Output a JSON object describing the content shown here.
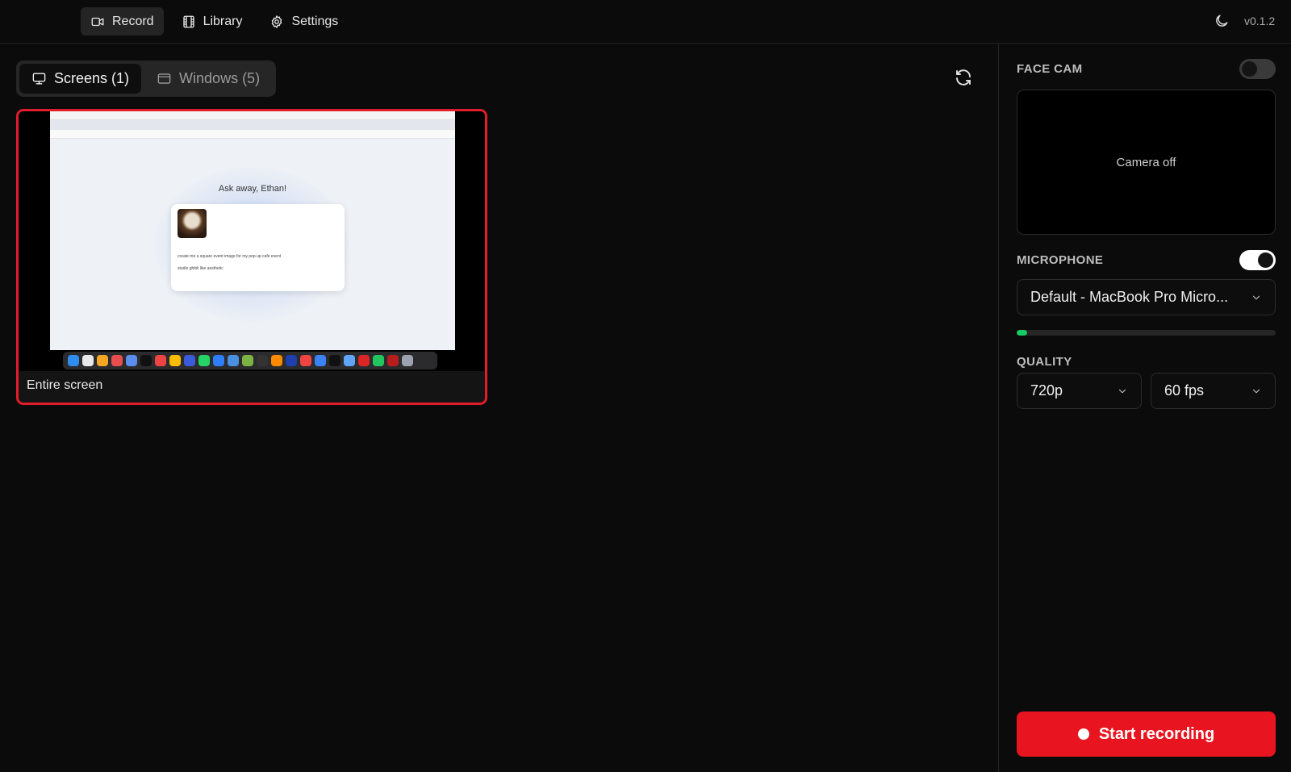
{
  "nav": {
    "items": [
      {
        "label": "Record",
        "icon": "video-camera-icon",
        "active": true
      },
      {
        "label": "Library",
        "icon": "film-icon",
        "active": false
      },
      {
        "label": "Settings",
        "icon": "gear-icon",
        "active": false
      }
    ]
  },
  "header": {
    "version": "v0.1.2",
    "theme_icon": "moon-icon"
  },
  "sources": {
    "tabs": [
      {
        "label": "Screens (1)",
        "icon": "monitor-icon",
        "active": true
      },
      {
        "label": "Windows (5)",
        "icon": "window-icon",
        "active": false
      }
    ],
    "refresh_icon": "refresh-icon",
    "cards": [
      {
        "label": "Entire screen",
        "selected": true,
        "preview": {
          "greeting": "Ask away, Ethan!",
          "prompt_line_1": "create me a square event image for my pop up cafe event",
          "prompt_line_2": "studio ghibli like aesthetic"
        }
      }
    ]
  },
  "panel": {
    "face_cam": {
      "title": "FACE CAM",
      "enabled": false,
      "placeholder": "Camera off"
    },
    "microphone": {
      "title": "MICROPHONE",
      "enabled": true,
      "device": "Default - MacBook Pro Micro...",
      "level": 0.04
    },
    "quality": {
      "title": "QUALITY",
      "resolution": "720p",
      "fps": "60 fps"
    },
    "start_label": "Start recording"
  },
  "colors": {
    "accent_red": "#e8141f",
    "selection_border": "#e11d2a",
    "level_green": "#18c964"
  }
}
